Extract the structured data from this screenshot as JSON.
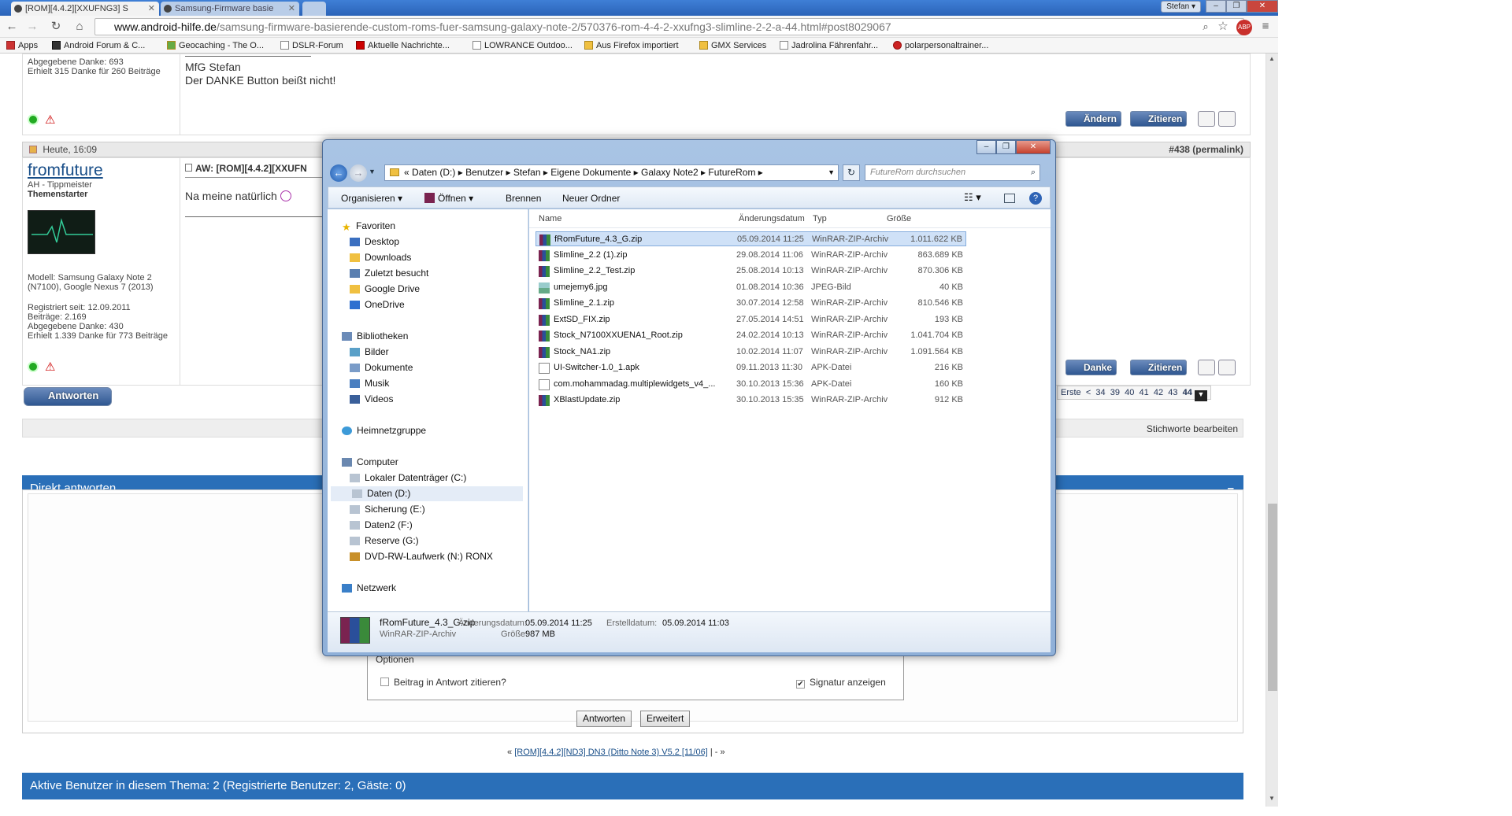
{
  "browser": {
    "tabs": [
      {
        "label": "[ROM][4.4.2][XXUFNG3] S",
        "active": true
      },
      {
        "label": "Samsung-Firmware basie",
        "active": false
      }
    ],
    "user": "Stefan",
    "url_host": "www.android-hilfe.de",
    "url_path": "/samsung-firmware-basierende-custom-roms-fuer-samsung-galaxy-note-2/570376-rom-4-4-2-xxufng3-slimline-2-2-a-44.html#post8029067",
    "bookmarks": [
      "Apps",
      "Android Forum & C...",
      "Geocaching - The O...",
      "DSLR-Forum",
      "Aktuelle Nachrichte...",
      "LOWRANCE Outdoo...",
      "Aus Firefox importiert",
      "GMX Services",
      "Jadrolina Fährenfahr...",
      "polarpersonaltrainer..."
    ]
  },
  "prev_post": {
    "side_lines": [
      "Abgegebene Danke: 693",
      "Erhielt 315 Danke für 260 Beiträge"
    ],
    "body": [
      "MfG Stefan",
      "Der DANKE Button beißt nicht!"
    ],
    "btn_edit": "Ändern",
    "btn_quote": "Zitieren"
  },
  "post": {
    "time": "Heute, 16:09",
    "number": "#438 (permalink)",
    "author": "fromfuture",
    "rank": "AH - Tippmeister",
    "badge": "Themenstarter",
    "device": "Modell: Samsung Galaxy Note 2 (N7100), Google Nexus 7 (2013)",
    "stats": [
      "Registriert seit: 12.09.2011",
      "Beiträge: 2.169",
      "Abgegebene Danke: 430",
      "Erhielt 1.339 Danke für 773 Beiträge"
    ],
    "title": "AW: [ROM][4.4.2][XXUFN",
    "body": "Na meine natürlich",
    "btn_thanks": "Danke",
    "btn_quote": "Zitieren"
  },
  "reply_button": "Antworten",
  "pager": {
    "first": "Erste",
    "prev": "<",
    "pages": [
      "34",
      "39",
      "40",
      "41",
      "42",
      "43"
    ],
    "current": "44"
  },
  "tags_link": "Stichworte bearbeiten",
  "quick_reply": {
    "title": "Direkt antworten",
    "collapse": "–",
    "options_label": "Optionen",
    "quote_label": "Beitrag in Antwort zitieren?",
    "signature_label": "Signatur anzeigen",
    "signature_checked": "✔",
    "btn_reply": "Antworten",
    "btn_advanced": "Erweitert"
  },
  "thread_nav": {
    "prefix": "«",
    "link": "[ROM][4.4.2][ND3] DN3 (Ditto Note 3) V5.2 [11/06]",
    "suffix": "| - »"
  },
  "active_users": "Aktive Benutzer in diesem Thema: 2 (Registrierte Benutzer: 2, Gäste: 0)",
  "dialog": {
    "breadcrumb": [
      "«",
      "Daten (D:)",
      "Benutzer",
      "Stefan",
      "Eigene Dokumente",
      "Galaxy Note2",
      "FutureRom"
    ],
    "search_placeholder": "FutureRom durchsuchen",
    "toolbar": {
      "organize": "Organisieren",
      "open": "Öffnen",
      "burn": "Brennen",
      "new_folder": "Neuer Ordner"
    },
    "nav": {
      "favorites": "Favoriten",
      "fav_items": [
        "Desktop",
        "Downloads",
        "Zuletzt besucht",
        "Google Drive",
        "OneDrive"
      ],
      "libraries": "Bibliotheken",
      "lib_items": [
        "Bilder",
        "Dokumente",
        "Musik",
        "Videos"
      ],
      "homegroup": "Heimnetzgruppe",
      "computer": "Computer",
      "drives": [
        "Lokaler Datenträger (C:)",
        "Daten (D:)",
        "Sicherung (E:)",
        "Daten2 (F:)",
        "Reserve (G:)",
        "DVD-RW-Laufwerk (N:) RONX"
      ],
      "network": "Netzwerk"
    },
    "columns": {
      "name": "Name",
      "date": "Änderungsdatum",
      "type": "Typ",
      "size": "Größe"
    },
    "files": [
      {
        "name": "fRomFuture_4.3_G.zip",
        "date": "05.09.2014 11:25",
        "type": "WinRAR-ZIP-Archiv",
        "size": "1.011.622 KB",
        "icon": "rar-icon"
      },
      {
        "name": "Slimline_2.2 (1).zip",
        "date": "29.08.2014 11:06",
        "type": "WinRAR-ZIP-Archiv",
        "size": "863.689 KB",
        "icon": "rar-icon"
      },
      {
        "name": "Slimline_2.2_Test.zip",
        "date": "25.08.2014 10:13",
        "type": "WinRAR-ZIP-Archiv",
        "size": "870.306 KB",
        "icon": "rar-icon"
      },
      {
        "name": "umejemy6.jpg",
        "date": "01.08.2014 10:36",
        "type": "JPEG-Bild",
        "size": "40 KB",
        "icon": "image-icon"
      },
      {
        "name": "Slimline_2.1.zip",
        "date": "30.07.2014 12:58",
        "type": "WinRAR-ZIP-Archiv",
        "size": "810.546 KB",
        "icon": "rar-icon"
      },
      {
        "name": "ExtSD_FIX.zip",
        "date": "27.05.2014 14:51",
        "type": "WinRAR-ZIP-Archiv",
        "size": "193 KB",
        "icon": "rar-icon"
      },
      {
        "name": "Stock_N7100XXUENA1_Root.zip",
        "date": "24.02.2014 10:13",
        "type": "WinRAR-ZIP-Archiv",
        "size": "1.041.704 KB",
        "icon": "rar-icon"
      },
      {
        "name": "Stock_NA1.zip",
        "date": "10.02.2014 11:07",
        "type": "WinRAR-ZIP-Archiv",
        "size": "1.091.564 KB",
        "icon": "rar-icon"
      },
      {
        "name": "UI-Switcher-1.0_1.apk",
        "date": "09.11.2013 11:30",
        "type": "APK-Datei",
        "size": "216 KB",
        "icon": "file-icon"
      },
      {
        "name": "com.mohammadag.multiplewidgets_v4_...",
        "date": "30.10.2013 15:36",
        "type": "APK-Datei",
        "size": "160 KB",
        "icon": "file-icon"
      },
      {
        "name": "XBlastUpdate.zip",
        "date": "30.10.2013 15:35",
        "type": "WinRAR-ZIP-Archiv",
        "size": "912 KB",
        "icon": "rar-icon"
      }
    ],
    "details": {
      "name": "fRomFuture_4.3_G.zip",
      "type": "WinRAR-ZIP-Archiv",
      "mod_label": "Änderungsdatum:",
      "mod_value": "05.09.2014 11:25",
      "created_label": "Erstelldatum:",
      "created_value": "05.09.2014 11:03",
      "size_label": "Größe:",
      "size_value": "987 MB"
    }
  }
}
